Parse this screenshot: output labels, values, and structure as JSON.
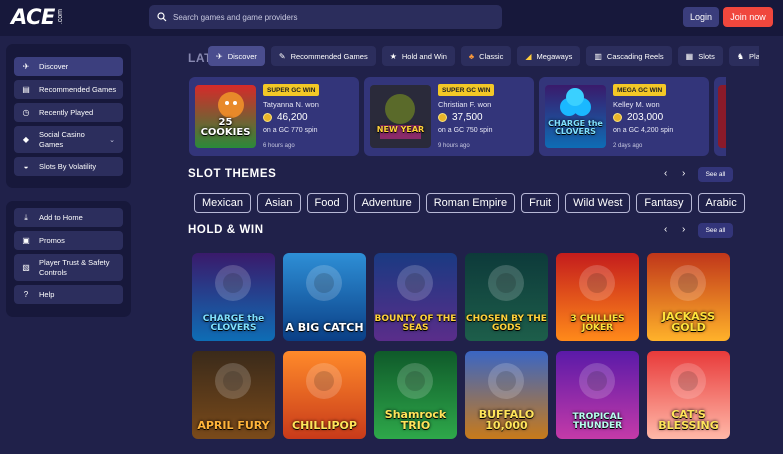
{
  "header": {
    "logo_text": "ACE",
    "logo_sub": ".com",
    "search_placeholder": "Search games and game providers",
    "login_label": "Login",
    "join_label": "Join now"
  },
  "sidebar": {
    "main_items": [
      {
        "label": "Discover",
        "icon": "discover-icon"
      },
      {
        "label": "Recommended Games",
        "icon": "cards-icon"
      },
      {
        "label": "Recently Played",
        "icon": "clock-icon"
      },
      {
        "label": "Social Casino Games",
        "icon": "dice-icon"
      },
      {
        "label": "Slots By Volatility",
        "icon": "gauge-icon"
      }
    ],
    "secondary_items": [
      {
        "label": "Add to Home",
        "icon": "download-icon"
      },
      {
        "label": "Promos",
        "icon": "gift-icon"
      },
      {
        "label": "Player Trust & Safety Controls",
        "icon": "shield-icon"
      },
      {
        "label": "Help",
        "icon": "help-icon"
      }
    ]
  },
  "tabs": [
    {
      "label": "Discover",
      "icon": "discover-icon"
    },
    {
      "label": "Recommended Games",
      "icon": "cards-icon"
    },
    {
      "label": "Hold and Win",
      "icon": "star-icon"
    },
    {
      "label": "Classic",
      "icon": "cherry-icon"
    },
    {
      "label": "Megaways",
      "icon": "megaways-icon"
    },
    {
      "label": "Cascading Reels",
      "icon": "reels-icon"
    },
    {
      "label": "Slots",
      "icon": "slots-icon"
    },
    {
      "label": "Pla",
      "icon": "cat-icon"
    }
  ],
  "latest": {
    "title": "LAT",
    "wins": [
      {
        "badge": "SUPER GC WIN",
        "winner": "Tatyanna N. won",
        "amount": "46,200",
        "spin": "on a GC 770 spin",
        "ago": "6 hours ago",
        "game": "25 COOKIES",
        "badge_color": "#f3c826"
      },
      {
        "badge": "SUPER GC WIN",
        "winner": "Christian F. won",
        "amount": "37,500",
        "spin": "on a GC 750 spin",
        "ago": "9 hours ago",
        "game": "NEW YEAR",
        "badge_color": "#f3c826"
      },
      {
        "badge": "MEGA GC WIN",
        "winner": "Kelley M. won",
        "amount": "203,000",
        "spin": "on a GC 4,200 spin",
        "ago": "2 days ago",
        "game": "CHARGE the CLOVERS",
        "badge_color": "#f3c826"
      }
    ]
  },
  "slot_themes": {
    "title": "SLOT THEMES",
    "see_all": "See all",
    "chips": [
      "Mexican",
      "Asian",
      "Food",
      "Adventure",
      "Roman Empire",
      "Fruit",
      "Wild West",
      "Fantasy",
      "Arabic"
    ]
  },
  "hold_win": {
    "title": "HOLD & WIN",
    "see_all": "See all",
    "games": [
      {
        "title": "CHARGE the CLOVERS",
        "bg1": "#3a1a6b",
        "bg2": "#0e6db5",
        "color": "#7fe0ff"
      },
      {
        "title": "A BIG CATCH",
        "bg1": "#2e8fd6",
        "bg2": "#0a3f86",
        "color": "#ffffff"
      },
      {
        "title": "BOUNTY OF THE SEAS",
        "bg1": "#1a3a82",
        "bg2": "#5a2d8a",
        "color": "#ffd23a"
      },
      {
        "title": "CHOSEN BY THE GODS",
        "bg1": "#0d3a3a",
        "bg2": "#1d5e4a",
        "color": "#ffd23a"
      },
      {
        "title": "3 CHILLIES JOKER",
        "bg1": "#c41c1c",
        "bg2": "#ff8a1a",
        "color": "#ffe23a"
      },
      {
        "title": "JACKASS GOLD",
        "bg1": "#c0361a",
        "bg2": "#ffb22a",
        "color": "#ffe23a"
      },
      {
        "title": "APRIL FURY",
        "bg1": "#3a2a1a",
        "bg2": "#7a4a1a",
        "color": "#ffb43a"
      },
      {
        "title": "CHILLIPOP",
        "bg1": "#ff8a2a",
        "bg2": "#c83a1a",
        "color": "#ffe45a"
      },
      {
        "title": "Shamrock TRIO",
        "bg1": "#0f5a2a",
        "bg2": "#2ea84a",
        "color": "#ffe45a"
      },
      {
        "title": "BUFFALO 10,000",
        "bg1": "#3a66c4",
        "bg2": "#c87a1a",
        "color": "#ffe45a"
      },
      {
        "title": "TROPICAL THUNDER",
        "bg1": "#5a1aa8",
        "bg2": "#c43aa8",
        "color": "#b8fff0"
      },
      {
        "title": "CAT'S BLESSING",
        "bg1": "#e83a3a",
        "bg2": "#ffb8a8",
        "color": "#ffe45a"
      }
    ]
  }
}
